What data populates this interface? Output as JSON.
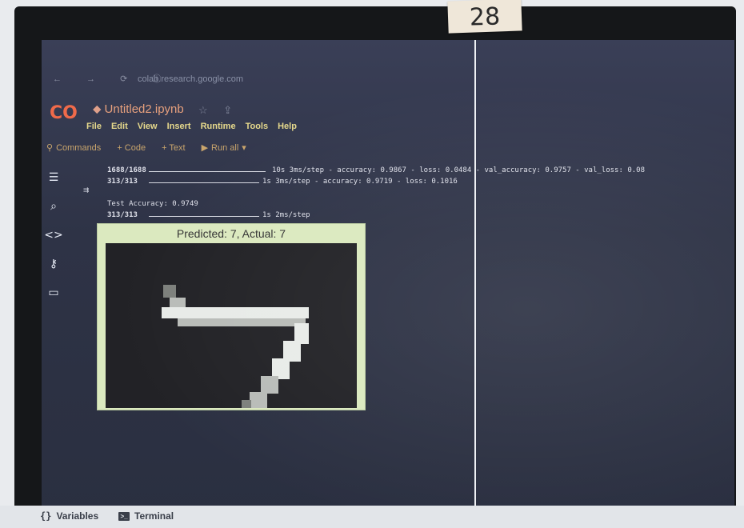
{
  "tab_label": "28",
  "browser": {
    "url": "colab.research.google.com"
  },
  "notebook": {
    "title": "Untitled2.ipynb",
    "menu": [
      "File",
      "Edit",
      "View",
      "Insert",
      "Runtime",
      "Tools",
      "Help"
    ],
    "toolbar": {
      "commands": "Commands",
      "code": "+ Code",
      "text": "+ Text",
      "run_all": "Run all"
    }
  },
  "output": {
    "lines": [
      {
        "steps": "1688/1688",
        "rest": "10s 3ms/step - accuracy: 0.9867 - loss: 0.0484 - val_accuracy: 0.9757 - val_loss: 0.08"
      },
      {
        "steps": "313/313",
        "rest": "1s 3ms/step - accuracy: 0.9719 - loss: 0.1016"
      },
      {
        "text": "Test Accuracy: 0.9749"
      },
      {
        "steps": "313/313",
        "rest": "1s 2ms/step"
      }
    ],
    "figure_title": "Predicted: 7, Actual: 7"
  },
  "bottom": {
    "variables": "Variables",
    "terminal": "Terminal"
  }
}
